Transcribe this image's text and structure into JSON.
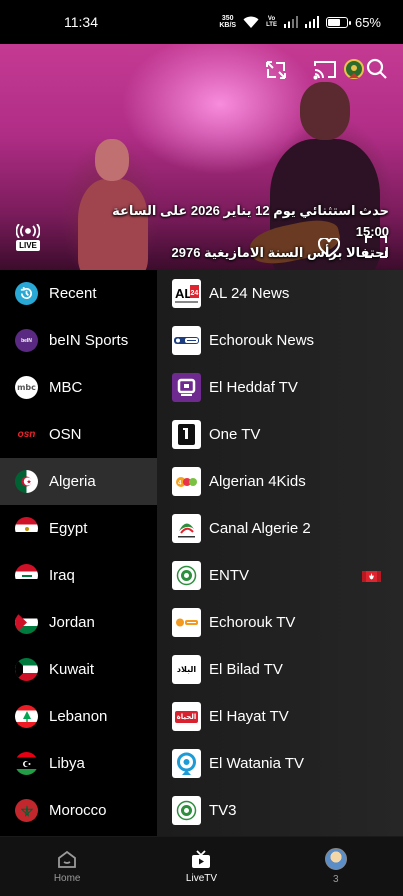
{
  "status_bar": {
    "time": "11:34",
    "net_speed_value": "350",
    "net_speed_unit": "KB/S",
    "volte_top": "Vo",
    "volte_bottom": "LTE",
    "battery_text": "65%",
    "battery_level": 0.65
  },
  "player": {
    "ticker_line1": "حدث استثنائي يوم 12 يناير 2026 على الساعة 15:00",
    "ticker_line2": "احتفالا برأس السنة الامازيغية 2976",
    "live_label": "LIVE",
    "icons": [
      "switch-source-icon",
      "cast-icon",
      "channel-emblem-icon",
      "search-icon",
      "heart-icon",
      "fullscreen-icon",
      "live-broadcast-icon"
    ]
  },
  "categories": [
    {
      "label": "Recent",
      "icon": "recent-icon",
      "color": "#29a8d6"
    },
    {
      "label": "beIN Sports",
      "icon": "bein-sports-icon",
      "color": "#5a2a82"
    },
    {
      "label": "MBC",
      "icon": "mbc-icon",
      "color": "#ffffff"
    },
    {
      "label": "OSN",
      "icon": "osn-icon",
      "color": "#e8232a"
    },
    {
      "label": "Algeria",
      "icon": "algeria-flag-icon",
      "active": true
    },
    {
      "label": "Egypt",
      "icon": "egypt-flag-icon"
    },
    {
      "label": "Iraq",
      "icon": "iraq-flag-icon"
    },
    {
      "label": "Jordan",
      "icon": "jordan-flag-icon"
    },
    {
      "label": "Kuwait",
      "icon": "kuwait-flag-icon"
    },
    {
      "label": "Lebanon",
      "icon": "lebanon-flag-icon"
    },
    {
      "label": "Libya",
      "icon": "libya-flag-icon"
    },
    {
      "label": "Morocco",
      "icon": "morocco-flag-icon"
    }
  ],
  "channels": [
    {
      "label": "AL 24 News",
      "logo": "al24-news-logo"
    },
    {
      "label": "Echorouk News",
      "logo": "echorouk-news-logo"
    },
    {
      "label": "El Heddaf TV",
      "logo": "el-heddaf-logo"
    },
    {
      "label": "One TV",
      "logo": "one-tv-logo"
    },
    {
      "label": "Algerian 4Kids",
      "logo": "algerian-4kids-logo"
    },
    {
      "label": "Canal Algerie 2",
      "logo": "canal-algerie-logo"
    },
    {
      "label": "ENTV",
      "logo": "entv-logo",
      "badge": "canada-flag-icon"
    },
    {
      "label": "Echorouk TV",
      "logo": "echorouk-tv-logo"
    },
    {
      "label": "El Bilad TV",
      "logo": "el-bilad-logo",
      "logo_text": "البلاد"
    },
    {
      "label": "El Hayat TV",
      "logo": "el-hayat-logo",
      "logo_text": "الحياة"
    },
    {
      "label": "El Watania TV",
      "logo": "el-watania-logo"
    },
    {
      "label": "TV3",
      "logo": "tv3-logo"
    }
  ],
  "bottom_nav": {
    "home_label": "Home",
    "livetv_label": "LiveTV",
    "profile_label": "3"
  },
  "colors": {
    "accent_red": "#e0242f",
    "sidebar_active": "#2e2e2e"
  }
}
